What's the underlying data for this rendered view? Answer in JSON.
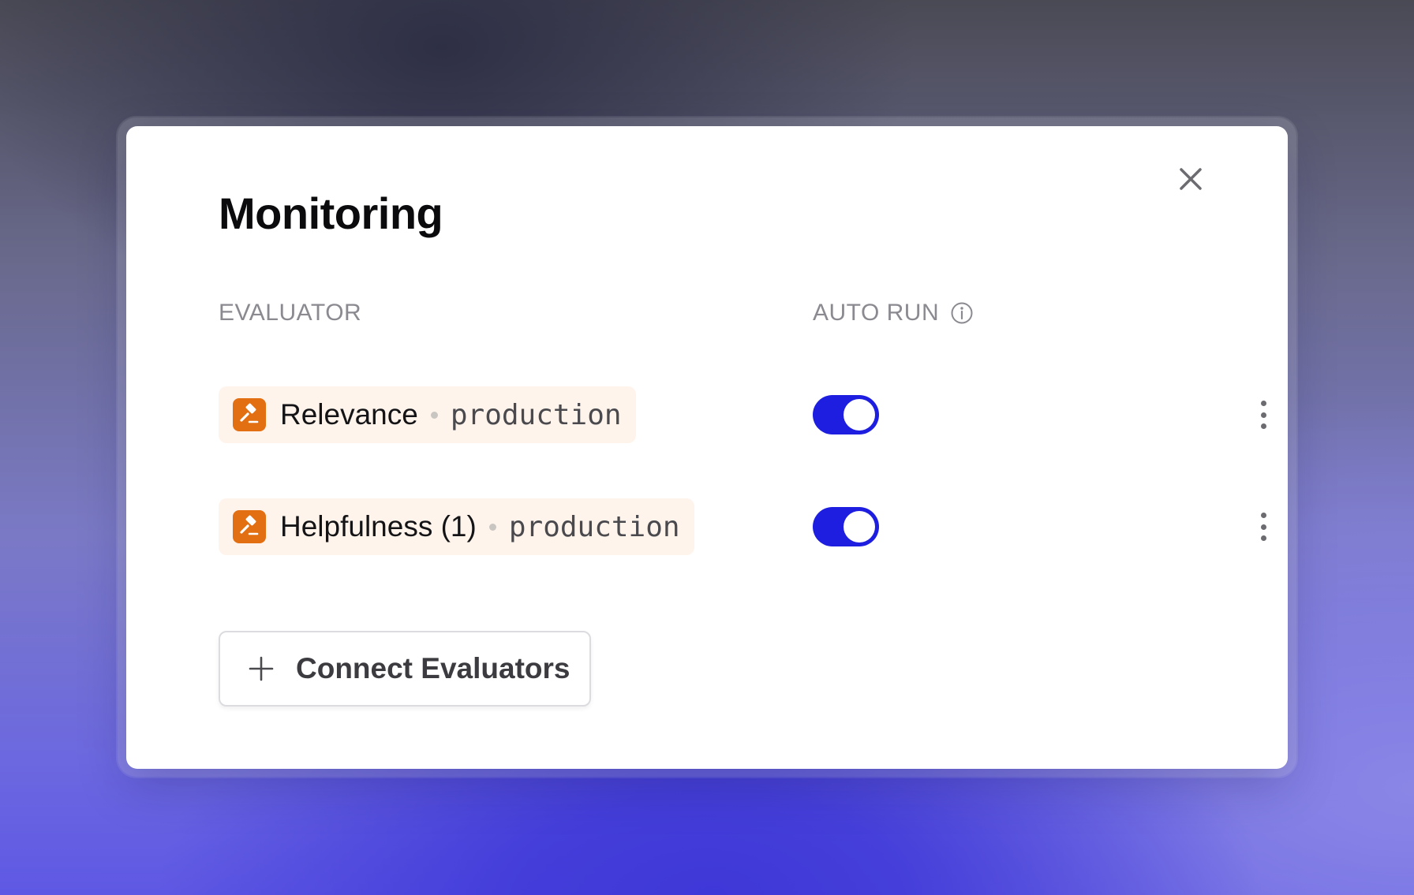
{
  "modal": {
    "title": "Monitoring",
    "close_icon": "close-icon"
  },
  "table": {
    "headers": {
      "evaluator": "EVALUATOR",
      "auto_run": "AUTO RUN",
      "auto_run_icon": "info-icon"
    },
    "rows": [
      {
        "name": "Relevance",
        "environment": "production",
        "auto_run": true,
        "icon": "gavel-icon",
        "menu_icon": "more-vertical-icon"
      },
      {
        "name": "Helpfulness (1)",
        "environment": "production",
        "auto_run": true,
        "icon": "gavel-icon",
        "menu_icon": "more-vertical-icon"
      }
    ]
  },
  "actions": {
    "connect_label": "Connect Evaluators",
    "connect_icon": "plus-icon"
  },
  "colors": {
    "toggle_on": "#1d1ee0",
    "evaluator_icon_bg": "#e36f13",
    "chip_bg": "#fff4ec"
  }
}
